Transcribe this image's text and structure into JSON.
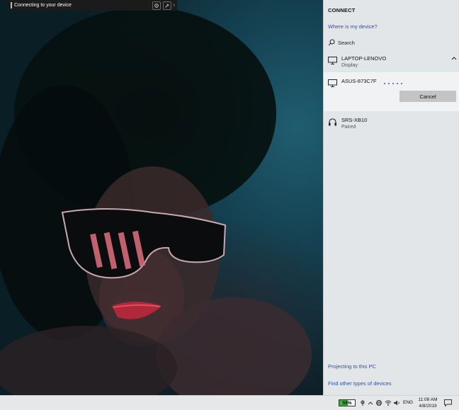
{
  "projection_bar": {
    "status": "Connecting to your device",
    "icons": [
      "settings-icon",
      "pin-icon"
    ],
    "collapse": "›"
  },
  "connect_pane": {
    "title": "CONNECT",
    "help_link": "Where is my device?",
    "search_label": "Search",
    "devices": [
      {
        "name": "LAPTOP-LENOVO",
        "status": "Display",
        "icon": "monitor-icon"
      },
      {
        "name": "ASUS-873C7F",
        "status": "",
        "icon": "monitor-icon",
        "action": "Cancel"
      },
      {
        "name": "SRS-XB10",
        "status": "Paired",
        "icon": "headphones-icon"
      }
    ],
    "footer_links": [
      "Projecting to this PC",
      "Find other types of devices"
    ]
  },
  "taskbar": {
    "battery_percent": "55%",
    "battery_level": 0.55,
    "language": "ENG",
    "time": "11:08 AM",
    "date": "4/8/2019",
    "accent_battery": "#2fb332"
  }
}
